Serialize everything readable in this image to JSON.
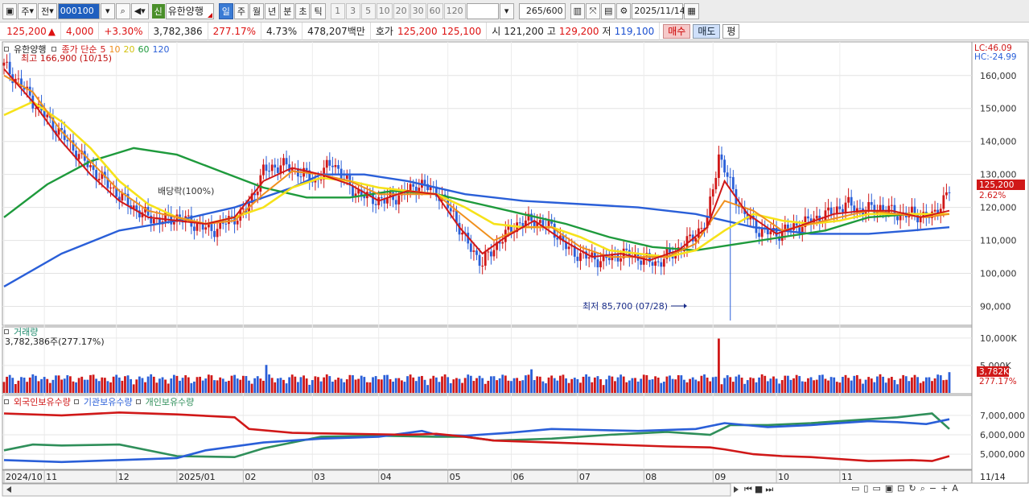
{
  "toolbar": {
    "main_tab": "주",
    "prev_label": "전",
    "code": "000100",
    "stock_name": "유한양행",
    "new_badge": "신",
    "periods": [
      "일",
      "주",
      "월",
      "년",
      "분",
      "초",
      "틱"
    ],
    "active_period": "일",
    "minutes": [
      "1",
      "3",
      "5",
      "10",
      "20",
      "30",
      "60",
      "120"
    ],
    "count": "265",
    "count_total": "/600",
    "date": "2025/11/14"
  },
  "quote": {
    "price": "125,200",
    "arrow": "▲",
    "change": "4,000",
    "change_pct": "+3.30%",
    "volume": "3,782,386",
    "vol_ratio": "277.17%",
    "turnover_pct": "4.73%",
    "amount": "478,207백만",
    "ask_label": "호가",
    "ask": "125,200",
    "bid": "125,100",
    "open_label": "시",
    "open": "121,200",
    "high_label": "고",
    "high": "129,200",
    "low_label": "저",
    "low": "119,100",
    "buy_label": "매수",
    "sell_label": "매도",
    "avg_label": "평"
  },
  "price_panel": {
    "legend_name": "유한양행",
    "legend_type": "종가 단순",
    "ma_periods": [
      "5",
      "10",
      "20",
      "60",
      "120"
    ],
    "high_note": "최고 166,900 (10/15)",
    "low_note": "최저 85,700 (07/28)",
    "dividend_note": "배당락(100%)",
    "lc": "LC:46.09",
    "hc": "HC:-24.99",
    "y_ticks": [
      "160,000",
      "150,000",
      "140,000",
      "130,000",
      "120,000",
      "110,000",
      "100,000",
      "90,000"
    ],
    "current_price": "125,200",
    "current_pct": "2.62%"
  },
  "volume_panel": {
    "title": "거래량",
    "value": "3,782,386주(277.17%)",
    "y_ticks": [
      "10,000K",
      "5,000K"
    ],
    "current": "3,782K",
    "current_pct": "277.17%"
  },
  "holder_panel": {
    "legend": [
      "외국인보유수량",
      "기관보유수량",
      "개인보유수량"
    ],
    "y_ticks": [
      "7,000,000",
      "6,000,000",
      "5,000,000"
    ]
  },
  "x_axis": {
    "labels": [
      "2024/10",
      "11",
      "12",
      "2025/01",
      "02",
      "03",
      "04",
      "05",
      "06",
      "07",
      "08",
      "09",
      "10",
      "11"
    ],
    "end_label": "11/14"
  },
  "colors": {
    "candle_up": "#d01818",
    "ma5": "#d01818",
    "ma10": "#f0901e",
    "ma20": "#f6e21a",
    "ma60": "#1e9a3c",
    "ma120": "#2a5fd8",
    "foreign": "#d01818",
    "institution": "#2a5fd8",
    "individual": "#2f8f5a"
  },
  "chart_data": {
    "type": "candlestick",
    "x_range": [
      "2024/10",
      "11/14"
    ],
    "price_ylim": [
      85000,
      168000
    ],
    "price_path": [
      [
        0,
        163000
      ],
      [
        6,
        157000
      ],
      [
        12,
        150000
      ],
      [
        18,
        144000
      ],
      [
        24,
        138000
      ],
      [
        30,
        132000
      ],
      [
        36,
        127000
      ],
      [
        42,
        122000
      ],
      [
        48,
        118000
      ],
      [
        54,
        116000
      ],
      [
        60,
        117000
      ],
      [
        66,
        115000
      ],
      [
        72,
        113000
      ],
      [
        78,
        116000
      ],
      [
        84,
        119000
      ],
      [
        90,
        131000
      ],
      [
        96,
        133000
      ],
      [
        102,
        131000
      ],
      [
        108,
        128000
      ],
      [
        114,
        134000
      ],
      [
        120,
        126000
      ],
      [
        126,
        123000
      ],
      [
        132,
        122000
      ],
      [
        138,
        124000
      ],
      [
        144,
        127000
      ],
      [
        150,
        125000
      ],
      [
        156,
        118000
      ],
      [
        160,
        110000
      ],
      [
        166,
        103000
      ],
      [
        172,
        110000
      ],
      [
        178,
        115000
      ],
      [
        184,
        116000
      ],
      [
        190,
        114000
      ],
      [
        196,
        107000
      ],
      [
        202,
        105000
      ],
      [
        208,
        104000
      ],
      [
        214,
        106000
      ],
      [
        220,
        105000
      ],
      [
        226,
        103000
      ],
      [
        232,
        106000
      ],
      [
        238,
        110000
      ],
      [
        244,
        116000
      ],
      [
        248,
        136000
      ],
      [
        252,
        127000
      ],
      [
        256,
        119000
      ],
      [
        262,
        113000
      ],
      [
        268,
        112000
      ],
      [
        274,
        114000
      ],
      [
        280,
        116000
      ],
      [
        286,
        118000
      ],
      [
        292,
        121000
      ],
      [
        298,
        119000
      ],
      [
        304,
        120000
      ],
      [
        310,
        118000
      ],
      [
        316,
        118000
      ],
      [
        322,
        117000
      ],
      [
        328,
        125200
      ]
    ],
    "ma5": [
      [
        0,
        162000
      ],
      [
        10,
        152000
      ],
      [
        20,
        140000
      ],
      [
        30,
        130000
      ],
      [
        40,
        122000
      ],
      [
        50,
        117000
      ],
      [
        60,
        116000
      ],
      [
        70,
        115000
      ],
      [
        80,
        117000
      ],
      [
        90,
        128000
      ],
      [
        100,
        132000
      ],
      [
        110,
        130000
      ],
      [
        120,
        127000
      ],
      [
        130,
        122000
      ],
      [
        140,
        125000
      ],
      [
        150,
        124000
      ],
      [
        158,
        114000
      ],
      [
        166,
        106000
      ],
      [
        174,
        111000
      ],
      [
        184,
        116000
      ],
      [
        194,
        110000
      ],
      [
        204,
        105000
      ],
      [
        214,
        106000
      ],
      [
        224,
        104000
      ],
      [
        234,
        107000
      ],
      [
        244,
        114000
      ],
      [
        250,
        128000
      ],
      [
        258,
        118000
      ],
      [
        268,
        112000
      ],
      [
        278,
        115000
      ],
      [
        288,
        118000
      ],
      [
        298,
        119000
      ],
      [
        308,
        119000
      ],
      [
        318,
        117000
      ],
      [
        328,
        119000
      ]
    ],
    "ma10": [
      [
        0,
        160000
      ],
      [
        10,
        155000
      ],
      [
        20,
        143000
      ],
      [
        30,
        134000
      ],
      [
        40,
        125000
      ],
      [
        50,
        119000
      ],
      [
        60,
        117000
      ],
      [
        70,
        115000
      ],
      [
        80,
        116000
      ],
      [
        90,
        124000
      ],
      [
        100,
        131000
      ],
      [
        110,
        130000
      ],
      [
        120,
        128000
      ],
      [
        130,
        124000
      ],
      [
        140,
        124000
      ],
      [
        150,
        124000
      ],
      [
        160,
        117000
      ],
      [
        170,
        110000
      ],
      [
        180,
        114000
      ],
      [
        190,
        114000
      ],
      [
        200,
        108000
      ],
      [
        210,
        105000
      ],
      [
        220,
        105000
      ],
      [
        230,
        105000
      ],
      [
        240,
        109000
      ],
      [
        250,
        122000
      ],
      [
        260,
        119000
      ],
      [
        270,
        113000
      ],
      [
        280,
        115000
      ],
      [
        290,
        117000
      ],
      [
        300,
        119000
      ],
      [
        310,
        118000
      ],
      [
        320,
        117000
      ],
      [
        328,
        118000
      ]
    ],
    "ma20": [
      [
        0,
        148000
      ],
      [
        10,
        152000
      ],
      [
        20,
        146000
      ],
      [
        30,
        138000
      ],
      [
        40,
        128000
      ],
      [
        50,
        121000
      ],
      [
        60,
        117000
      ],
      [
        70,
        115000
      ],
      [
        80,
        117000
      ],
      [
        90,
        120000
      ],
      [
        100,
        126000
      ],
      [
        110,
        129000
      ],
      [
        120,
        128000
      ],
      [
        130,
        126000
      ],
      [
        140,
        125000
      ],
      [
        150,
        124000
      ],
      [
        160,
        120000
      ],
      [
        170,
        115000
      ],
      [
        180,
        114000
      ],
      [
        190,
        114000
      ],
      [
        200,
        111000
      ],
      [
        210,
        107000
      ],
      [
        220,
        106000
      ],
      [
        230,
        105000
      ],
      [
        240,
        107000
      ],
      [
        250,
        113000
      ],
      [
        260,
        118000
      ],
      [
        270,
        116000
      ],
      [
        280,
        115000
      ],
      [
        290,
        116000
      ],
      [
        300,
        118000
      ],
      [
        310,
        118000
      ],
      [
        320,
        118000
      ],
      [
        328,
        118000
      ]
    ],
    "ma60": [
      [
        0,
        117000
      ],
      [
        15,
        127000
      ],
      [
        30,
        134000
      ],
      [
        45,
        138000
      ],
      [
        60,
        136000
      ],
      [
        75,
        131000
      ],
      [
        90,
        126000
      ],
      [
        105,
        123000
      ],
      [
        120,
        123000
      ],
      [
        135,
        125000
      ],
      [
        150,
        124000
      ],
      [
        165,
        121000
      ],
      [
        180,
        118000
      ],
      [
        195,
        115000
      ],
      [
        210,
        111000
      ],
      [
        225,
        108000
      ],
      [
        240,
        107000
      ],
      [
        255,
        109000
      ],
      [
        270,
        111000
      ],
      [
        285,
        113000
      ],
      [
        300,
        117000
      ],
      [
        315,
        118000
      ],
      [
        328,
        118000
      ]
    ],
    "ma120": [
      [
        0,
        96000
      ],
      [
        20,
        106000
      ],
      [
        40,
        113000
      ],
      [
        60,
        116000
      ],
      [
        80,
        120000
      ],
      [
        100,
        126000
      ],
      [
        110,
        130000
      ],
      [
        125,
        130000
      ],
      [
        140,
        128000
      ],
      [
        160,
        124000
      ],
      [
        180,
        122000
      ],
      [
        200,
        121000
      ],
      [
        220,
        120000
      ],
      [
        240,
        118000
      ],
      [
        260,
        114000
      ],
      [
        280,
        112000
      ],
      [
        300,
        112000
      ],
      [
        315,
        113000
      ],
      [
        328,
        114000
      ]
    ]
  }
}
